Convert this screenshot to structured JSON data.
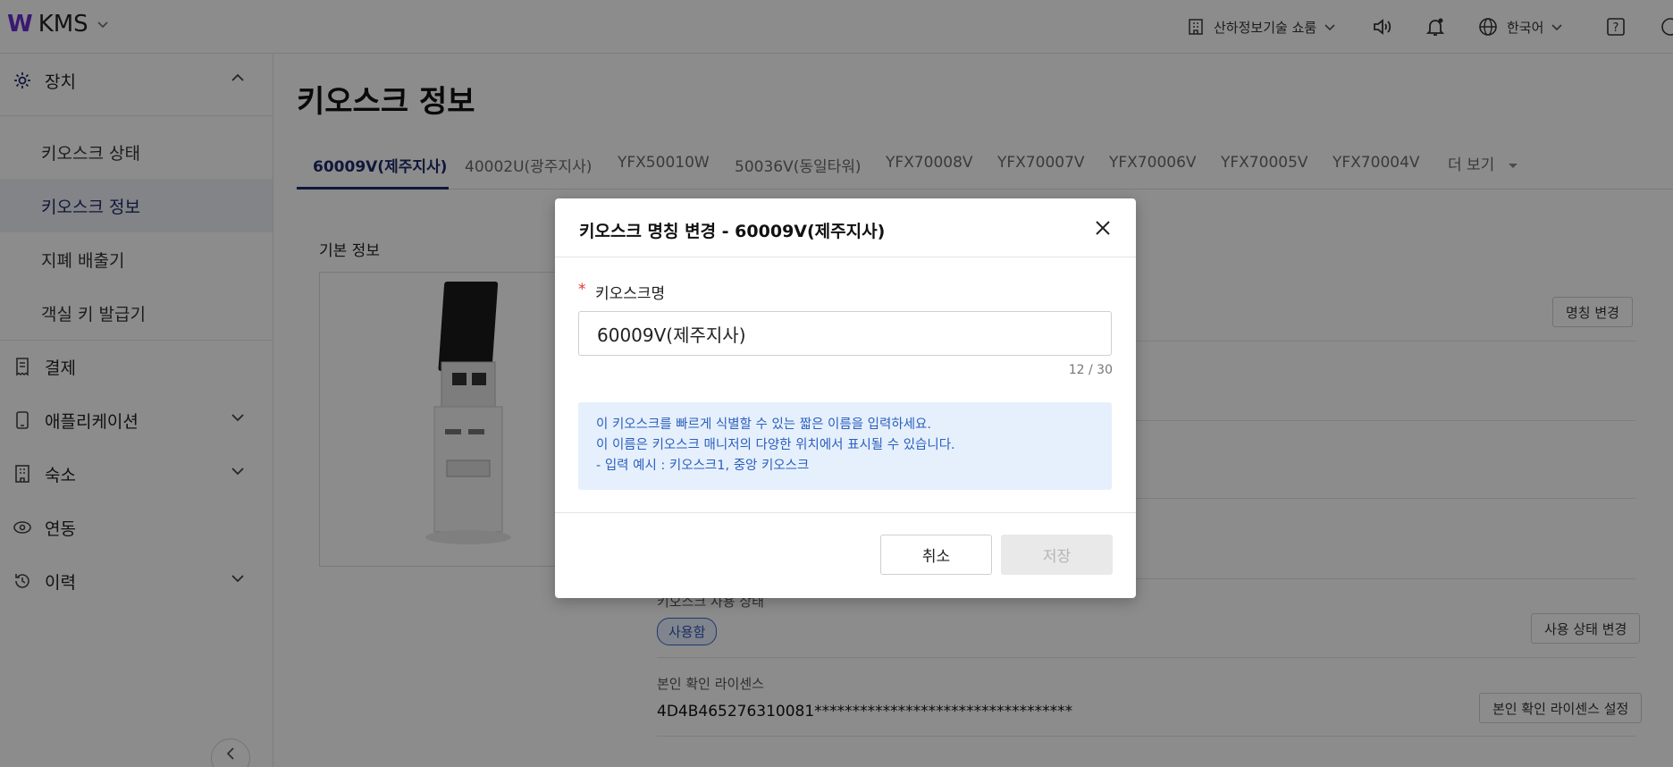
{
  "app": {
    "brand_mark": "W",
    "brand_name": "KMS",
    "store_selector": "산하정보기술 쇼룸",
    "language": "한국어"
  },
  "sidebar": {
    "groups": [
      {
        "label": "장치",
        "icon": "gear-icon",
        "expanded": true
      },
      {
        "label": "결제",
        "icon": "receipt-icon"
      },
      {
        "label": "애플리케이션",
        "icon": "device-icon"
      },
      {
        "label": "숙소",
        "icon": "building-icon"
      },
      {
        "label": "연동",
        "icon": "link-icon"
      },
      {
        "label": "이력",
        "icon": "history-icon"
      }
    ],
    "device_items": [
      {
        "label": "키오스크 상태"
      },
      {
        "label": "키오스크 정보",
        "active": true
      },
      {
        "label": "지폐 배출기"
      },
      {
        "label": "객실 키 발급기"
      }
    ]
  },
  "main": {
    "title": "키오스크 정보",
    "tabs": [
      {
        "label": "60009V(제주지사)",
        "active": true
      },
      {
        "label": "40002U(광주지사)"
      },
      {
        "label": "YFX50010W"
      },
      {
        "label": "50036V(동일타워)"
      },
      {
        "label": "YFX70008V"
      },
      {
        "label": "YFX70007V"
      },
      {
        "label": "YFX70006V"
      },
      {
        "label": "YFX70005V"
      },
      {
        "label": "YFX70004V"
      },
      {
        "label": "더 보기"
      }
    ],
    "section_label": "기본 정보",
    "rename_button": "명칭 변경",
    "usage_status_label": "키오스크 사용 상태",
    "usage_status_value": "사용함",
    "usage_status_button": "사용 상태 변경",
    "license_label": "본인 확인 라이센스",
    "license_value": "4D4B465276310081**********************************",
    "license_button": "본인 확인 라이센스 설정"
  },
  "modal": {
    "title": "키오스크 명칭 변경 - 60009V(제주지사)",
    "required_mark": "*",
    "field_label": "키오스크명",
    "field_value": "60009V(제주지사)",
    "counter": "12 / 30",
    "help_lines": [
      "이 키오스크를 빠르게 식별할 수 있는 짧은 이름을 입력하세요.",
      "이 이름은 키오스크 매니저의 다양한 위치에서 표시될 수 있습니다.",
      "- 입력 예시 : 키오스크1, 중앙 키오스크"
    ],
    "cancel_label": "취소",
    "save_label": "저장"
  },
  "colors": {
    "accent": "#1d2a6b",
    "brand": "#6a2fd1",
    "help_text": "#2a5fbf",
    "help_bg": "#e6f0fc",
    "required": "#e0352b"
  }
}
